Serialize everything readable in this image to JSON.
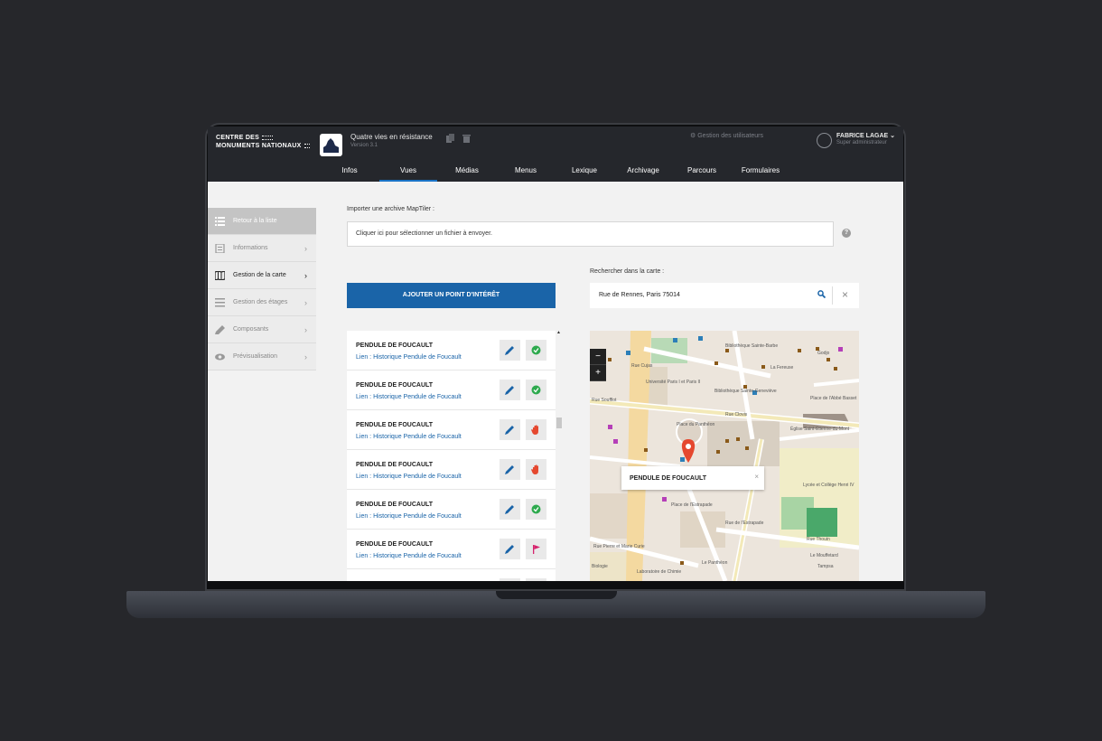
{
  "header": {
    "logo_line1": "CENTRE DES",
    "logo_line2": "MONUMENTS NATIONAUX",
    "app_title": "Quatre vies en résistance",
    "app_version": "Version 3.1",
    "user_management": "Gestion des utilisateurs",
    "user_name": "FABRICE LAGAE",
    "user_role": "Super administrateur"
  },
  "nav": {
    "tabs": [
      "Infos",
      "Vues",
      "Médias",
      "Menus",
      "Lexique",
      "Archivage",
      "Parcours",
      "Formulaires"
    ],
    "active": "Vues"
  },
  "sidebar": {
    "items": [
      {
        "label": "Retour à la liste",
        "icon": "list-icon"
      },
      {
        "label": "Informations",
        "icon": "document-icon"
      },
      {
        "label": "Gestion de la carte",
        "icon": "map-icon"
      },
      {
        "label": "Gestion des étages",
        "icon": "menu-icon"
      },
      {
        "label": "Composants",
        "icon": "pencil-icon"
      },
      {
        "label": "Prévisualisation",
        "icon": "eye-icon"
      }
    ]
  },
  "main": {
    "import_label": "Importer une archive MapTiler :",
    "file_placeholder": "Cliquer ici pour sélectionner un fichier à envoyer.",
    "help": "?",
    "add_button": "AJOUTER UN POINT D'INTÉRÊT",
    "search_label": "Rechercher dans la carte :",
    "search_value": "Rue de Rennes, Paris 75014"
  },
  "poi": {
    "items": [
      {
        "title": "PENDULE DE FOUCAULT",
        "link": "Lien : Historique Pendule de Foucault",
        "status": "check",
        "status_color": "#2eaa4e"
      },
      {
        "title": "PENDULE DE FOUCAULT",
        "link": "Lien : Historique Pendule de Foucault",
        "status": "check",
        "status_color": "#2eaa4e"
      },
      {
        "title": "PENDULE DE FOUCAULT",
        "link": "Lien : Historique Pendule de Foucault",
        "status": "hand",
        "status_color": "#e5482f"
      },
      {
        "title": "PENDULE DE FOUCAULT",
        "link": "Lien : Historique Pendule de Foucault",
        "status": "hand",
        "status_color": "#e5482f"
      },
      {
        "title": "PENDULE DE FOUCAULT",
        "link": "Lien : Historique Pendule de Foucault",
        "status": "check",
        "status_color": "#2eaa4e"
      },
      {
        "title": "PENDULE DE FOUCAULT",
        "link": "Lien : Historique Pendule de Foucault",
        "status": "flag",
        "status_color": "#d6246e"
      }
    ]
  },
  "map": {
    "popup_title": "PENDULE DE FOUCAULT",
    "zoom_out": "−",
    "zoom_in": "+",
    "labels": {
      "bib_barbe": "Bibliothèque Sainte-Barbe",
      "bib_genevieve": "Bibliothèque Sainte-Geneviève",
      "place_pantheon": "Place du Panthéon",
      "rue_cujas": "Rue Cujas",
      "rue_soufflot": "Rue Soufflot",
      "rue_clovis": "Rue Clovis",
      "place_abbe": "Place de l'Abbé Basset",
      "eglise": "Église Saint-Étienne-du-Mont",
      "lycee": "Lycée et Collège Henri IV",
      "estrapade": "Place de l'Estrapade",
      "rue_estrapade": "Rue de l'Estrapade",
      "rue_thouin": "Rue Thouin",
      "rue_curie": "Rue Pierre et Marie Curie",
      "le_pantheon": "Le Panthéon",
      "universite": "Université Paris I et Paris II",
      "la_fereuse": "La Fereuse",
      "godjo": "Godjo",
      "le_mouffetard": "Le Mouffetard",
      "biologie": "Biologie",
      "laboratoire": "Laboratoire de Chimie",
      "tampsa": "Tampsa",
      "place_pantheon_small": "Place du Panthéon"
    }
  },
  "colors": {
    "header_bg": "#25272c",
    "accent": "#1a64a8",
    "marker": "#e5482f"
  }
}
